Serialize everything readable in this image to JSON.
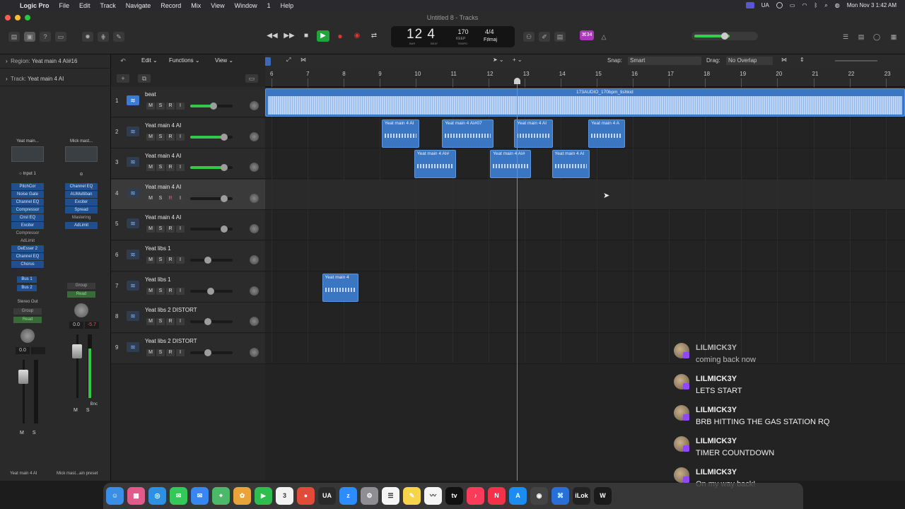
{
  "menubar": {
    "app": "Logic Pro",
    "items": [
      "File",
      "Edit",
      "Track",
      "Navigate",
      "Record",
      "Mix",
      "View",
      "Window",
      "1",
      "Help"
    ],
    "clock": "Mon Nov 3  1:42 AM",
    "ua": "UA"
  },
  "window": {
    "title": "Untitled 8 - Tracks"
  },
  "lcd": {
    "bar": "12",
    "beat": "4",
    "bar_label": "BAR",
    "beat_label": "BEAT",
    "tempo": "170",
    "tempo_label": "KEEP",
    "tempo_sub": "TEMPO",
    "signature": "4/4",
    "key": "F♯maj"
  },
  "badge": "⌘34",
  "inspector": {
    "region_label": "Region:",
    "region_name": "Yeat main 4 AI#16",
    "track_label": "Track:",
    "track_name": "Yeat main 4 AI",
    "strip1": {
      "name": "Yeat main...",
      "input": "Input 1",
      "plugins": [
        "PitchCor",
        "Noise Gate",
        "Channel EQ",
        "Compressor",
        "Cnsl EQ",
        "Exciter",
        "Compressor",
        "AdLimit",
        "DeEsser 2",
        "Channel EQ",
        "Chorus"
      ],
      "plugin_off": [
        false,
        false,
        false,
        false,
        false,
        false,
        true,
        true,
        false,
        false,
        false
      ],
      "sends": [
        "Bus 1",
        "Bus 2"
      ],
      "output": "Stereo Out",
      "group": "Group",
      "auto": "Read",
      "vol": "0.0",
      "peak": "",
      "ms": [
        "M",
        "S"
      ],
      "footer": "Yeat main 4 AI"
    },
    "strip2": {
      "name": "Mick mast...",
      "plugins": [
        "Channel EQ",
        "AUMultiban",
        "Exciter",
        "Spread",
        "Mastering",
        "AdLimit"
      ],
      "plugin_off": [
        false,
        false,
        false,
        false,
        true,
        false
      ],
      "group": "Group",
      "auto": "Read",
      "vol": "0.0",
      "peak": "-5.7",
      "bnc": "Bnc",
      "ms": [
        "M",
        "S"
      ],
      "footer": "Mick mast...ain preset"
    }
  },
  "tracklist": {
    "menus": [
      "Edit",
      "Functions",
      "View"
    ],
    "tracks": [
      {
        "num": "1",
        "name": "beat",
        "vol": 0.55,
        "green": true,
        "sel": false,
        "beat": true
      },
      {
        "num": "2",
        "name": "Yeat main 4 AI",
        "vol": 0.85,
        "green": true,
        "sel": false
      },
      {
        "num": "3",
        "name": "Yeat main 4 AI",
        "vol": 0.85,
        "green": true,
        "sel": false
      },
      {
        "num": "4",
        "name": "Yeat main 4 AI",
        "vol": 0.85,
        "green": false,
        "sel": true,
        "rec": true
      },
      {
        "num": "5",
        "name": "Yeat main 4 AI",
        "vol": 0.85,
        "green": false,
        "sel": false
      },
      {
        "num": "6",
        "name": "Yeat libs 1",
        "vol": 0.4,
        "green": false,
        "sel": false
      },
      {
        "num": "7",
        "name": "Yeat libs 1",
        "vol": 0.48,
        "green": false,
        "sel": false
      },
      {
        "num": "8",
        "name": "Yeat libs 2 DISTORT",
        "vol": 0.4,
        "green": false,
        "sel": false
      },
      {
        "num": "9",
        "name": "Yeat libs 2 DISTORT",
        "vol": 0.4,
        "green": false,
        "sel": false
      }
    ],
    "button_labels": [
      "M",
      "S",
      "R",
      "I"
    ]
  },
  "arrange": {
    "snap_label": "Snap:",
    "snap_value": "Smart",
    "drag_label": "Drag:",
    "drag_value": "No Overlap",
    "bars": [
      "6",
      "7",
      "8",
      "9",
      "10",
      "11",
      "12",
      "13",
      "14",
      "15",
      "16",
      "17",
      "18",
      "19",
      "20",
      "21",
      "22",
      "23"
    ],
    "first_bar": 6,
    "beat_region": "173AUDIO_170bpm_tishkid",
    "regions": [
      {
        "track": 2,
        "start": 9.05,
        "end": 10.1,
        "name": "Yeat main 4 AI"
      },
      {
        "track": 2,
        "start": 10.72,
        "end": 12.15,
        "name": "Yeat main 4 AI#07"
      },
      {
        "track": 2,
        "start": 12.72,
        "end": 13.78,
        "name": "Yeat main 4 AI"
      },
      {
        "track": 2,
        "start": 14.77,
        "end": 15.78,
        "name": "Yeat main 4 A"
      },
      {
        "track": 3,
        "start": 9.95,
        "end": 11.1,
        "name": "Yeat main 4 AI#"
      },
      {
        "track": 3,
        "start": 12.05,
        "end": 13.18,
        "name": "Yeat main 4 AI#"
      },
      {
        "track": 3,
        "start": 13.76,
        "end": 14.8,
        "name": "Yeat main 4 AI"
      },
      {
        "track": 7,
        "start": 7.4,
        "end": 8.4,
        "name": "Yeat main 4"
      }
    ],
    "playhead": 12.8
  },
  "chat": [
    {
      "user": "LILMICK3Y",
      "text": "coming back now",
      "faded": true
    },
    {
      "user": "LILMICK3Y",
      "text": "LETS START",
      "faded": false
    },
    {
      "user": "LILMICK3Y",
      "text": "BRB HITTING THE GAS STATION RQ",
      "faded": false
    },
    {
      "user": "LILMICK3Y",
      "text": "TIMER COUNTDOWN",
      "faded": false
    },
    {
      "user": "LILMICK3Y",
      "text": "On my way back!",
      "faded": false
    }
  ],
  "dock": {
    "apps": [
      {
        "icon": "finder-icon",
        "color": "#3a8ee6",
        "glyph": "☺"
      },
      {
        "icon": "launchpad-icon",
        "color": "#e05a8a",
        "glyph": "▦"
      },
      {
        "icon": "safari-icon",
        "color": "#2f8fe0",
        "glyph": "◎"
      },
      {
        "icon": "messages-icon",
        "color": "#34c759",
        "glyph": "✉"
      },
      {
        "icon": "mail-icon",
        "color": "#3a86f0",
        "glyph": "✉"
      },
      {
        "icon": "maps-icon",
        "color": "#4cb86a",
        "glyph": "⌖"
      },
      {
        "icon": "photos-icon",
        "color": "#e8a33a",
        "glyph": "✿"
      },
      {
        "icon": "facetime-icon",
        "color": "#2fbd4f",
        "glyph": "▶"
      },
      {
        "icon": "calendar-icon",
        "color": "#f2f2f2",
        "glyph": "3"
      },
      {
        "icon": "chrome-icon",
        "color": "#e04b3a",
        "glyph": "●"
      },
      {
        "icon": "ua-connect-icon",
        "color": "#2a2a2a",
        "glyph": "UA"
      },
      {
        "icon": "zoom-icon",
        "color": "#2d8cff",
        "glyph": "z"
      },
      {
        "icon": "settings-icon",
        "color": "#8e8e93",
        "glyph": "⚙"
      },
      {
        "icon": "reminders-icon",
        "color": "#f5f5f5",
        "glyph": "☰"
      },
      {
        "icon": "notes-icon",
        "color": "#f7d44c",
        "glyph": "✎"
      },
      {
        "icon": "freeform-icon",
        "color": "#f5f5f5",
        "glyph": "〰"
      },
      {
        "icon": "appletv-icon",
        "color": "#111",
        "glyph": "tv"
      },
      {
        "icon": "music-icon",
        "color": "#fa3c5a",
        "glyph": "♪"
      },
      {
        "icon": "news-icon",
        "color": "#f3324a",
        "glyph": "N"
      },
      {
        "icon": "appstore-icon",
        "color": "#1c8cf0",
        "glyph": "A"
      },
      {
        "icon": "logic-pro-icon",
        "color": "#444",
        "glyph": "◉"
      },
      {
        "icon": "xcode-icon",
        "color": "#2a6fd6",
        "glyph": "⌘"
      },
      {
        "icon": "ilok-icon",
        "color": "#222",
        "glyph": "iLok"
      },
      {
        "icon": "waves-icon",
        "color": "#1a1a1a",
        "glyph": "W"
      }
    ]
  }
}
